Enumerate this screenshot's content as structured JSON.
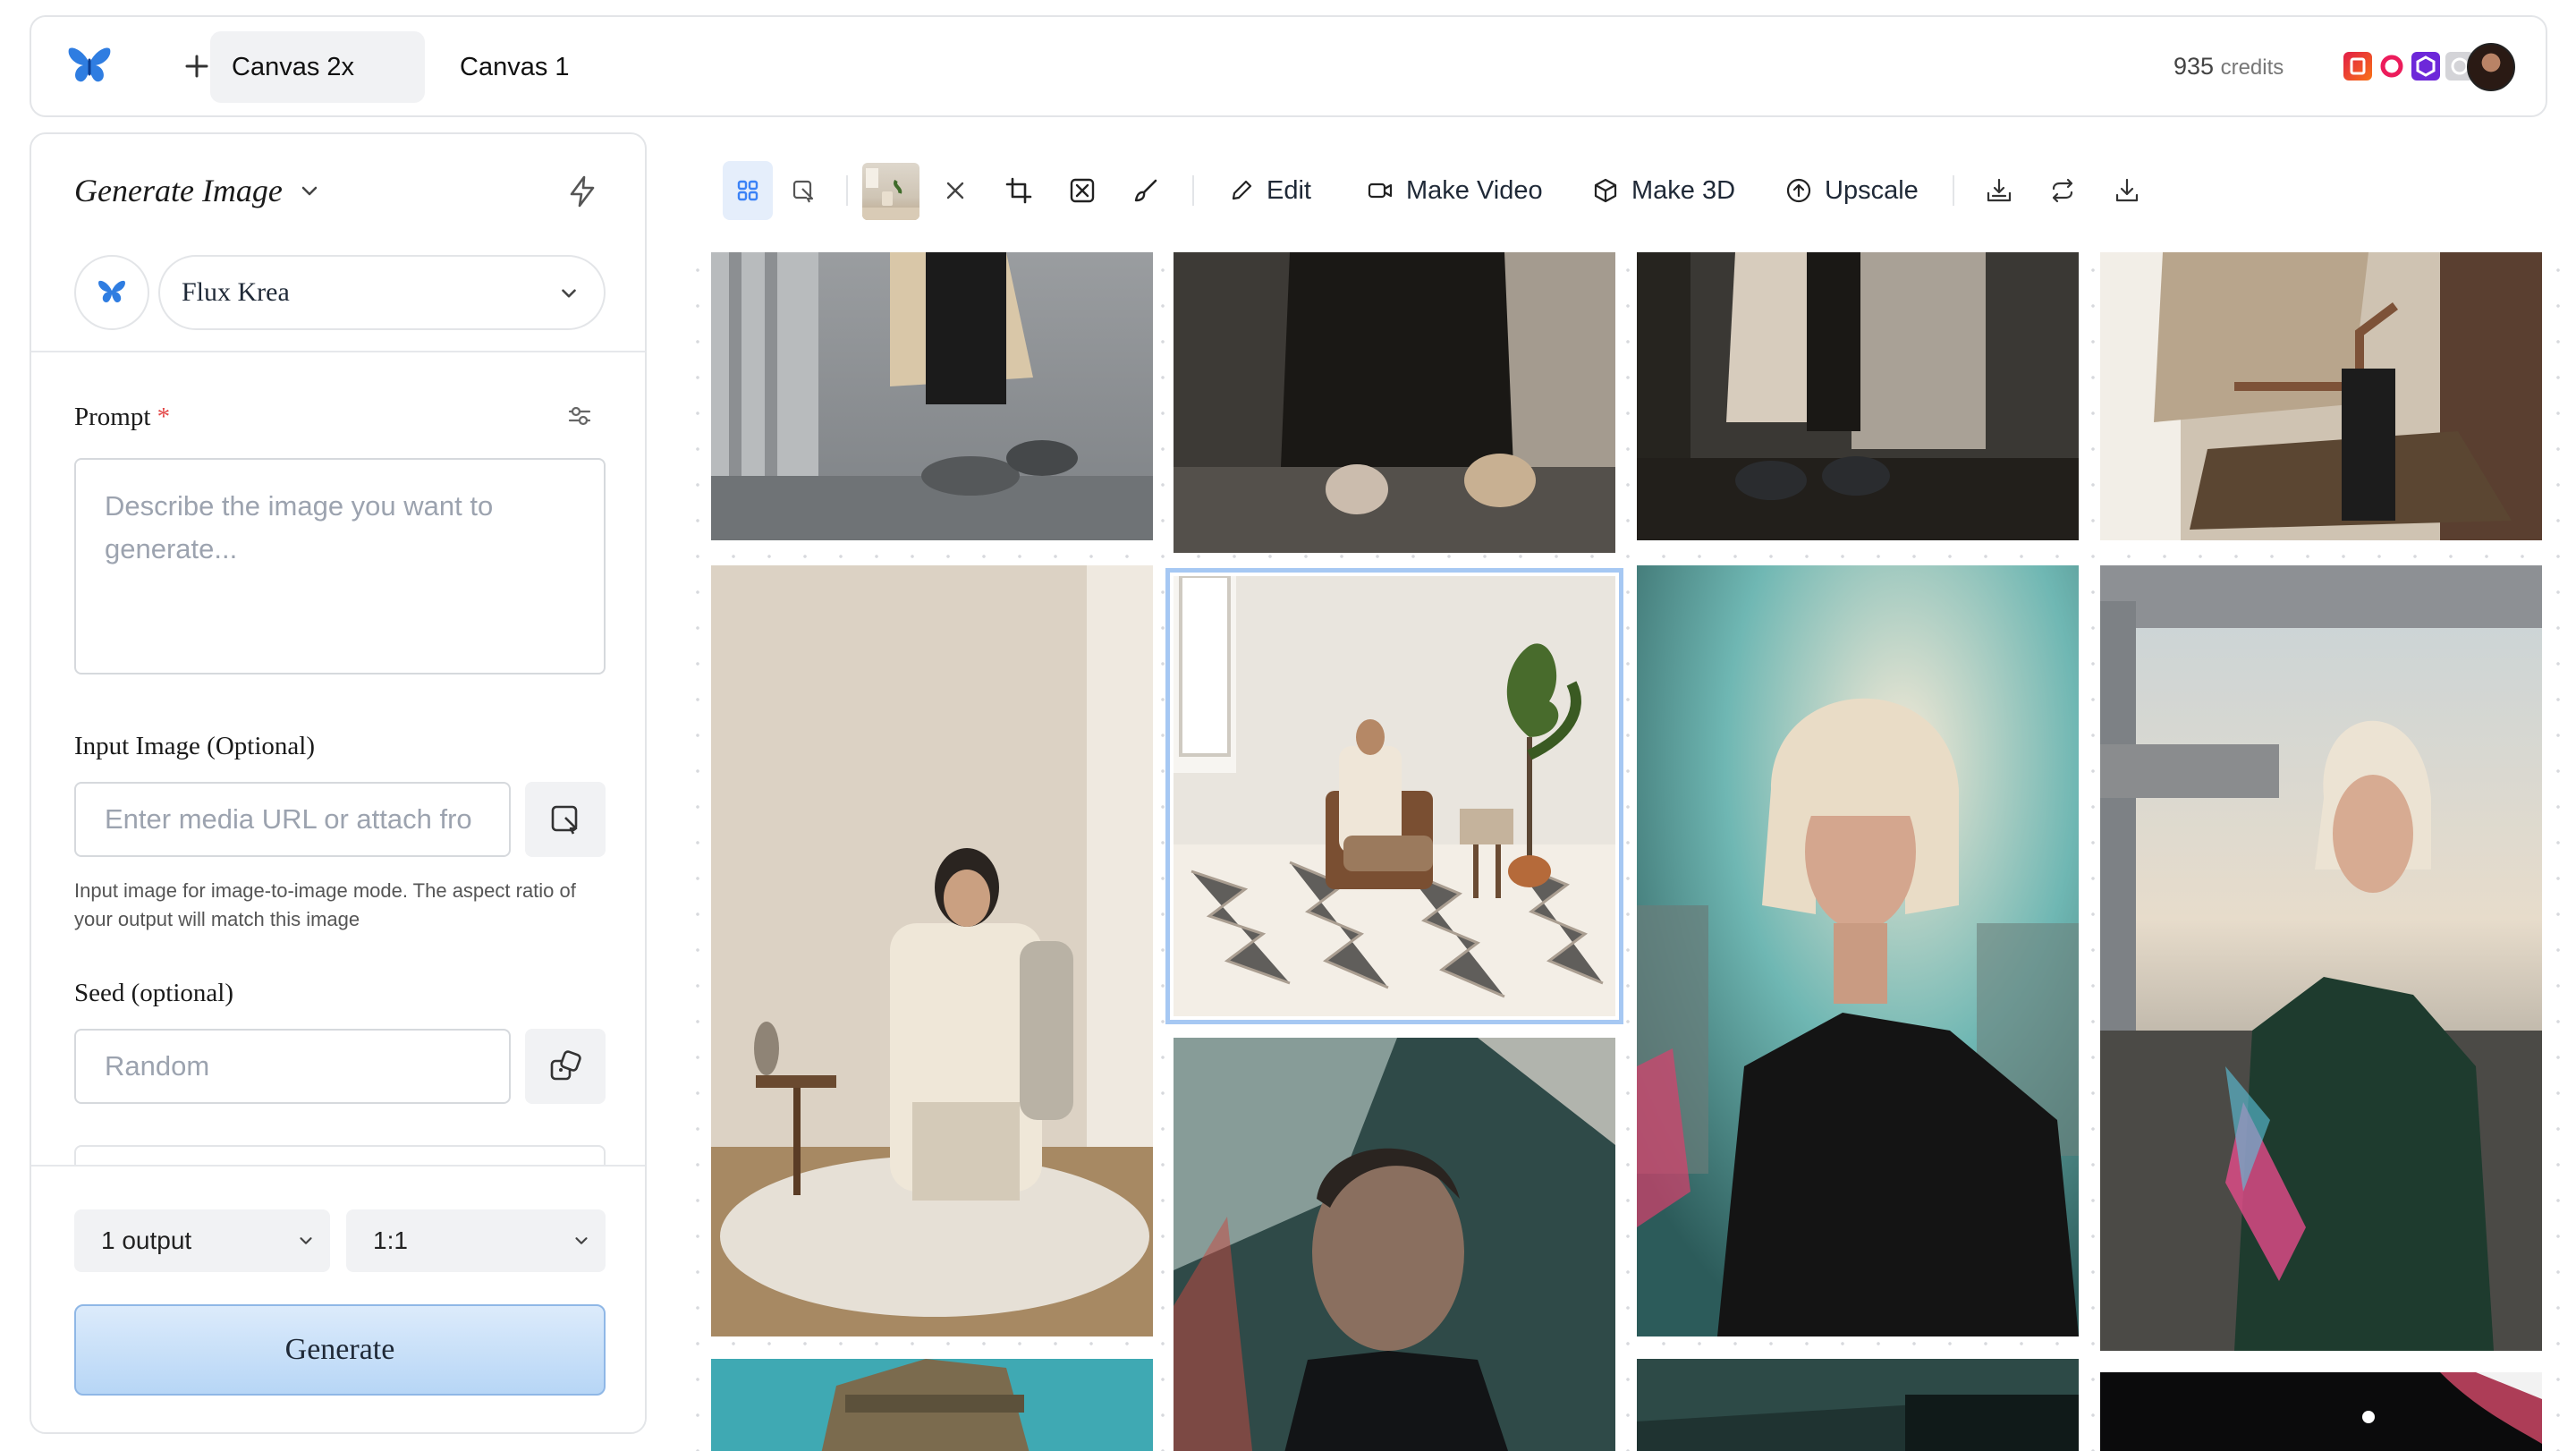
{
  "topbar": {
    "tabs": [
      {
        "label": "Canvas 2x",
        "active": true
      },
      {
        "label": "Canvas 1",
        "active": false
      }
    ],
    "credits_value": "935",
    "credits_label": "credits",
    "icons": [
      "butterfly-logo-icon",
      "plus-icon",
      "app-icon-red",
      "app-icon-pink",
      "app-icon-purple",
      "app-icon-grey",
      "avatar"
    ]
  },
  "panel": {
    "title": "Generate Image",
    "model": "Flux Krea",
    "prompt_label": "Prompt",
    "prompt_required": "*",
    "prompt_placeholder": "Describe the image you want to generate...",
    "input_image_label": "Input Image (Optional)",
    "input_image_placeholder": "Enter media URL or attach fro",
    "input_image_help": "Input image for image-to-image mode. The aspect ratio of your output will match this image",
    "seed_label": "Seed (optional)",
    "seed_placeholder": "Random",
    "outputs": "1 output",
    "aspect_ratio": "1:1",
    "generate_label": "Generate"
  },
  "toolbar": {
    "edit": "Edit",
    "make_video": "Make Video",
    "make_3d": "Make 3D",
    "upscale": "Upscale"
  },
  "colors": {
    "accent": "#3b82f6",
    "selection": "#a6c8f3",
    "generate_top": "#dcebfb",
    "generate_bottom": "#b7d6f6"
  }
}
